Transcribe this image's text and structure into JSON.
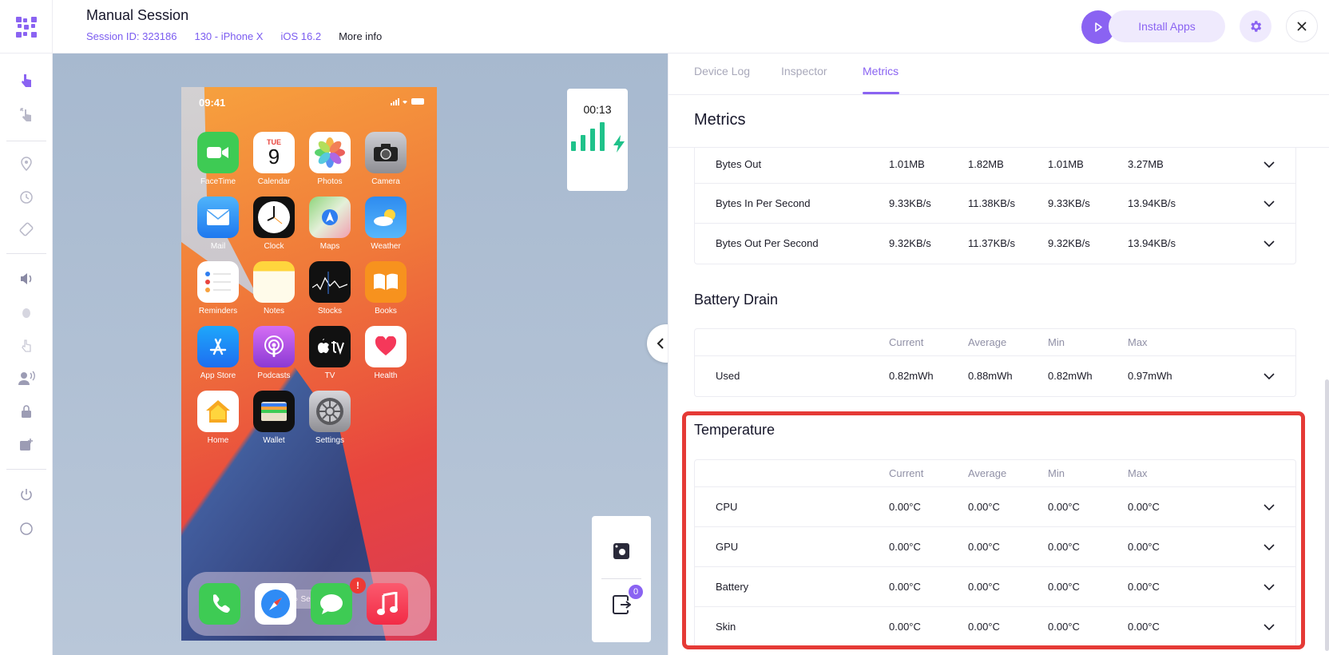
{
  "header": {
    "title": "Manual Session",
    "session_id": "Session ID: 323186",
    "device": "130 - iPhone X",
    "os": "iOS 16.2",
    "more_info": "More info",
    "install_apps": "Install Apps"
  },
  "sidebar": {
    "icons": [
      "touch-icon",
      "gesture-icon",
      "location-icon",
      "history-icon",
      "rotate-icon",
      "volume-icon",
      "debug-icon",
      "tap-icon",
      "voice-icon",
      "lock-icon",
      "image-add-icon",
      "power-icon",
      "home-circle-icon"
    ]
  },
  "phone": {
    "time": "09:41",
    "calendar_day": "TUE",
    "calendar_date": "9",
    "apps": [
      {
        "label": "FaceTime",
        "color": "#3ecb54",
        "icon": "facetime-icon"
      },
      {
        "label": "Calendar",
        "color": "#ffffff",
        "icon": "calendar-icon"
      },
      {
        "label": "Photos",
        "color": "#ffffff",
        "icon": "photos-icon"
      },
      {
        "label": "Camera",
        "color": "#8e8e93",
        "icon": "camera-icon"
      },
      {
        "label": "Mail",
        "color": "#2f8bf5",
        "icon": "mail-icon"
      },
      {
        "label": "Clock",
        "color": "#111111",
        "icon": "clock-icon"
      },
      {
        "label": "Maps",
        "color": "#7fd07a",
        "icon": "maps-icon"
      },
      {
        "label": "Weather",
        "color": "#3a8ef0",
        "icon": "weather-icon"
      },
      {
        "label": "Reminders",
        "color": "#ffffff",
        "icon": "reminders-icon"
      },
      {
        "label": "Notes",
        "color": "#fff6c9",
        "icon": "notes-icon"
      },
      {
        "label": "Stocks",
        "color": "#111111",
        "icon": "stocks-icon"
      },
      {
        "label": "Books",
        "color": "#f7921e",
        "icon": "books-icon"
      },
      {
        "label": "App Store",
        "color": "#1e8ef5",
        "icon": "app-store-icon"
      },
      {
        "label": "Podcasts",
        "color": "#b04ee0",
        "icon": "podcasts-icon"
      },
      {
        "label": "TV",
        "color": "#111111",
        "icon": "tv-icon"
      },
      {
        "label": "Health",
        "color": "#ffffff",
        "icon": "health-icon"
      },
      {
        "label": "Home",
        "color": "#ffffff",
        "icon": "home-icon"
      },
      {
        "label": "Wallet",
        "color": "#111111",
        "icon": "wallet-icon"
      },
      {
        "label": "Settings",
        "color": "#8e8e93",
        "icon": "settings-icon"
      }
    ],
    "search": "Search",
    "messages_badge": "!",
    "dock": [
      {
        "icon": "phone-icon",
        "color": "#3ecb54"
      },
      {
        "icon": "safari-icon",
        "color": "#ffffff"
      },
      {
        "icon": "messages-icon",
        "color": "#3ecb54"
      },
      {
        "icon": "music-icon",
        "color": "#f7344e"
      }
    ]
  },
  "session_timer": "00:13",
  "download_badge": "0",
  "tabs": {
    "device_log": "Device Log",
    "inspector": "Inspector",
    "metrics": "Metrics"
  },
  "metrics": {
    "title": "Metrics",
    "network_rows": [
      {
        "name": "Bytes Out",
        "current": "1.01MB",
        "average": "1.82MB",
        "min": "1.01MB",
        "max": "3.27MB"
      },
      {
        "name": "Bytes In Per Second",
        "current": "9.33KB/s",
        "average": "11.38KB/s",
        "min": "9.33KB/s",
        "max": "13.94KB/s"
      },
      {
        "name": "Bytes Out Per Second",
        "current": "9.32KB/s",
        "average": "11.37KB/s",
        "min": "9.32KB/s",
        "max": "13.94KB/s"
      }
    ],
    "columns": {
      "current": "Current",
      "average": "Average",
      "min": "Min",
      "max": "Max"
    },
    "battery": {
      "title": "Battery Drain",
      "rows": [
        {
          "name": "Used",
          "current": "0.82mWh",
          "average": "0.88mWh",
          "min": "0.82mWh",
          "max": "0.97mWh"
        }
      ]
    },
    "temperature": {
      "title": "Temperature",
      "rows": [
        {
          "name": "CPU",
          "current": "0.00°C",
          "average": "0.00°C",
          "min": "0.00°C",
          "max": "0.00°C"
        },
        {
          "name": "GPU",
          "current": "0.00°C",
          "average": "0.00°C",
          "min": "0.00°C",
          "max": "0.00°C"
        },
        {
          "name": "Battery",
          "current": "0.00°C",
          "average": "0.00°C",
          "min": "0.00°C",
          "max": "0.00°C"
        },
        {
          "name": "Skin",
          "current": "0.00°C",
          "average": "0.00°C",
          "min": "0.00°C",
          "max": "0.00°C"
        }
      ]
    }
  },
  "colors": {
    "accent": "#8a63f2",
    "highlight": "#e53a36",
    "signal": "#1fc28a"
  }
}
